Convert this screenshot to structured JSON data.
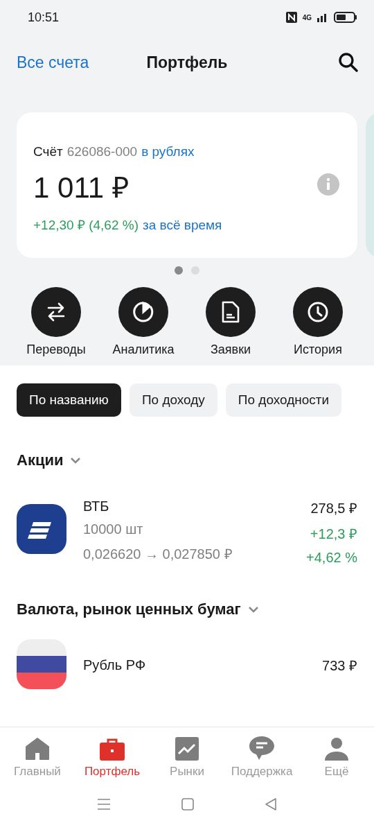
{
  "status_bar": {
    "time": "10:51",
    "network": "4G"
  },
  "header": {
    "back_link": "Все счета",
    "title": "Портфель"
  },
  "account_card": {
    "label": "Счёт",
    "number": "626086-000",
    "currency": "в рублях",
    "balance": "1 011 ₽",
    "change": "+12,30 ₽ (4,62 %)",
    "period": "за всё время"
  },
  "carousel_dots": [
    {
      "selected": true
    },
    {
      "selected": false
    }
  ],
  "actions": [
    {
      "kind": "transfer",
      "label": "Переводы"
    },
    {
      "kind": "analytics",
      "label": "Аналитика"
    },
    {
      "kind": "orders",
      "label": "Заявки"
    },
    {
      "kind": "history",
      "label": "История"
    }
  ],
  "sort_chips": [
    {
      "label": "По названию",
      "selected": true
    },
    {
      "label": "По доходу",
      "selected": false
    },
    {
      "label": "По доходности",
      "selected": false
    }
  ],
  "sections": [
    {
      "title": "Акции",
      "items": [
        {
          "kind": "bank",
          "name": "ВТБ",
          "quantity": "10000 шт",
          "price_change": "0,026620 → 0,027850 ₽",
          "value": "278,5 ₽",
          "profit": "+12,3 ₽",
          "profit_percent": "+4,62 %"
        }
      ]
    },
    {
      "title": "Валюта, рынок ценных бумаг",
      "items": [
        {
          "kind": "flag",
          "name": "Рубль РФ",
          "value": "733 ₽"
        }
      ]
    }
  ],
  "bottom_nav": [
    {
      "kind": "home",
      "label": "Главный",
      "selected": false
    },
    {
      "kind": "portfolio",
      "label": "Портфель",
      "selected": true
    },
    {
      "kind": "markets",
      "label": "Рынки",
      "selected": false
    },
    {
      "kind": "support",
      "label": "Поддержка",
      "selected": false
    },
    {
      "kind": "profile",
      "label": "Ещё",
      "selected": false
    }
  ]
}
